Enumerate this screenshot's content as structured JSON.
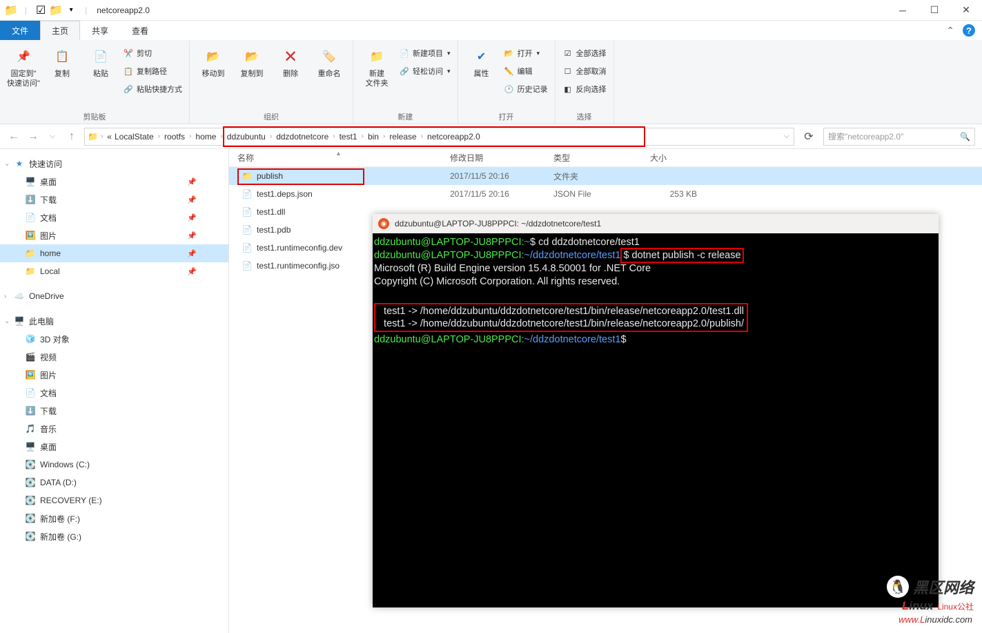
{
  "titlebar": {
    "title": "netcoreapp2.0"
  },
  "tabs": {
    "file": "文件",
    "home": "主页",
    "share": "共享",
    "view": "查看"
  },
  "ribbon": {
    "pin": "固定到\"\n快速访问\"",
    "copy": "复制",
    "paste": "粘贴",
    "cut": "剪切",
    "copypath": "复制路径",
    "pasteshortcut": "粘贴快捷方式",
    "clipboard": "剪贴板",
    "moveto": "移动到",
    "copyto": "复制到",
    "delete": "删除",
    "rename": "重命名",
    "organize": "组织",
    "newfolder": "新建\n文件夹",
    "newitem": "新建项目",
    "easyaccess": "轻松访问",
    "new": "新建",
    "properties": "属性",
    "open": "打开",
    "edit": "编辑",
    "history": "历史记录",
    "openlabel": "打开",
    "selectall": "全部选择",
    "selectnone": "全部取消",
    "invert": "反向选择",
    "select": "选择"
  },
  "breadcrumbs": [
    "LocalState",
    "rootfs",
    "home",
    "ddzubuntu",
    "ddzdotnetcore",
    "test1",
    "bin",
    "release",
    "netcoreapp2.0"
  ],
  "search_placeholder": "搜索\"netcoreapp2.0\"",
  "columns": {
    "name": "名称",
    "date": "修改日期",
    "type": "类型",
    "size": "大小"
  },
  "sidebar": {
    "quickaccess": "快速访问",
    "items1": [
      "桌面",
      "下载",
      "文档",
      "图片",
      "home",
      "Local"
    ],
    "onedrive": "OneDrive",
    "thispc": "此电脑",
    "items2": [
      "3D 对象",
      "视频",
      "图片",
      "文档",
      "下载",
      "音乐",
      "桌面",
      "Windows (C:)",
      "DATA (D:)",
      "RECOVERY (E:)",
      "新加卷 (F:)",
      "新加卷 (G:)"
    ]
  },
  "files": [
    {
      "name": "publish",
      "date": "2017/11/5 20:16",
      "type": "文件夹",
      "size": "",
      "icon": "folder"
    },
    {
      "name": "test1.deps.json",
      "date": "2017/11/5 20:16",
      "type": "JSON File",
      "size": "253 KB",
      "icon": "file"
    },
    {
      "name": "test1.dll",
      "date": "",
      "type": "",
      "size": "",
      "icon": "file"
    },
    {
      "name": "test1.pdb",
      "date": "",
      "type": "",
      "size": "",
      "icon": "file"
    },
    {
      "name": "test1.runtimeconfig.dev",
      "date": "",
      "type": "",
      "size": "",
      "icon": "file"
    },
    {
      "name": "test1.runtimeconfig.jso",
      "date": "",
      "type": "",
      "size": "",
      "icon": "file"
    }
  ],
  "terminal": {
    "title": "ddzubuntu@LAPTOP-JU8PPPCI: ~/ddzdotnetcore/test1",
    "line1_prompt": "ddzubuntu@LAPTOP-JU8PPPCI:",
    "line1_path": "~",
    "line1_cmd": "$ cd ddzdotnetcore/test1",
    "line2_prompt": "ddzubuntu@LAPTOP-JU8PPPCI:",
    "line2_path": "~/ddzdotnetcore/test1",
    "line2_cmd": "$ dotnet publish -c release",
    "line3": "Microsoft (R) Build Engine version 15.4.8.50001 for .NET Core",
    "line4": "Copyright (C) Microsoft Corporation. All rights reserved.",
    "line5": "  test1 -> /home/ddzubuntu/ddzdotnetcore/test1/bin/release/netcoreapp2.0/test1.dll",
    "line6": "  test1 -> /home/ddzubuntu/ddzdotnetcore/test1/bin/release/netcoreapp2.0/publish/",
    "line7_prompt": "ddzubuntu@LAPTOP-JU8PPPCI:",
    "line7_path": "~/ddzdotnetcore/test1",
    "line7_end": "$"
  },
  "watermark": {
    "text": "黑区网络",
    "url": "www.Linuxidc.com",
    "sub": "Linux公社"
  }
}
